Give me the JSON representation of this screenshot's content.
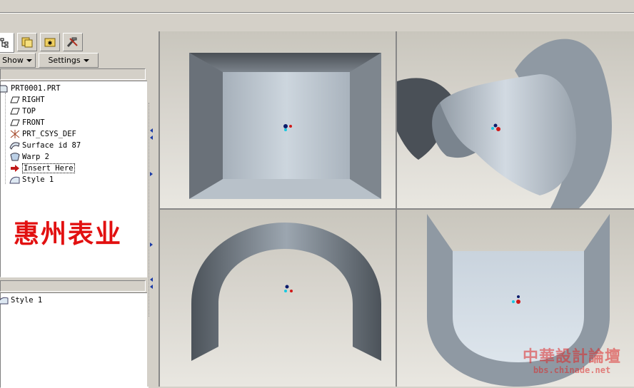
{
  "nav": {
    "tabs": [
      {
        "name": "model-tree"
      },
      {
        "name": "folder-browser"
      },
      {
        "name": "favorites"
      },
      {
        "name": "connections"
      }
    ],
    "show_label": "Show",
    "settings_label": "Settings"
  },
  "tree": {
    "items": [
      {
        "label": "PRT0001.PRT",
        "icon": "part-icon"
      },
      {
        "label": "RIGHT",
        "icon": "datum-plane-icon"
      },
      {
        "label": "TOP",
        "icon": "datum-plane-icon"
      },
      {
        "label": "FRONT",
        "icon": "datum-plane-icon"
      },
      {
        "label": "PRT_CSYS_DEF",
        "icon": "csys-icon"
      },
      {
        "label": "Surface id 87",
        "icon": "surface-icon"
      },
      {
        "label": "Warp 2",
        "icon": "warp-icon"
      },
      {
        "label": "Insert Here",
        "icon": "insert-arrow-icon"
      },
      {
        "label": "Style 1",
        "icon": "style-icon"
      }
    ]
  },
  "overlay_text": "惠州表业",
  "tree2": {
    "items": [
      {
        "label": "Style 1",
        "icon": "style-icon"
      }
    ]
  },
  "watermark": {
    "line1": "中華設計論壇",
    "line2": "bbs.chinade.net"
  },
  "colors": {
    "background": "#d4d0c8",
    "viewport_bg": "#d8d5ce",
    "surface_light": "#c9d3dd",
    "surface_dark": "#4a4f55",
    "overlay_red": "#e21010"
  }
}
